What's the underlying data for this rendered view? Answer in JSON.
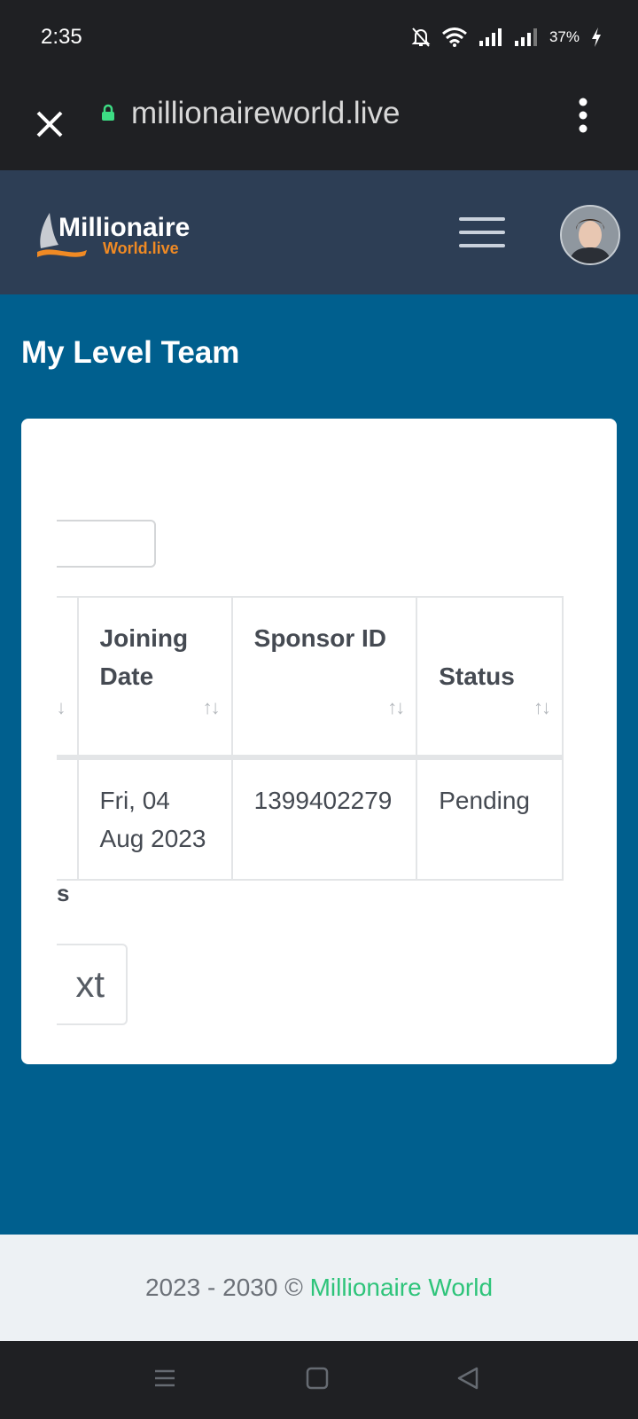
{
  "statusbar": {
    "time": "2:35",
    "battery": "37%"
  },
  "browser": {
    "url": "millionaireworld.live"
  },
  "logo": {
    "line1": "Millionaire",
    "line2": "World.live"
  },
  "page": {
    "title": "My Level Team"
  },
  "table": {
    "headers": {
      "joining_date": "Joining Date",
      "sponsor_id": "Sponsor ID",
      "status": "Status"
    },
    "rows": [
      {
        "joining_date": "Fri, 04 Aug 2023",
        "sponsor_id": "1399402279",
        "status": "Pending"
      }
    ]
  },
  "pagination": {
    "info_fragment": "s",
    "next_fragment": "xt"
  },
  "footer": {
    "years": "2023 - 2030 ©",
    "brand": "Millionaire World"
  },
  "colors": {
    "header_bg": "#2d3e55",
    "page_bg": "#005f8e",
    "brand_green": "#2ec47a",
    "logo_orange": "#f08a24"
  }
}
